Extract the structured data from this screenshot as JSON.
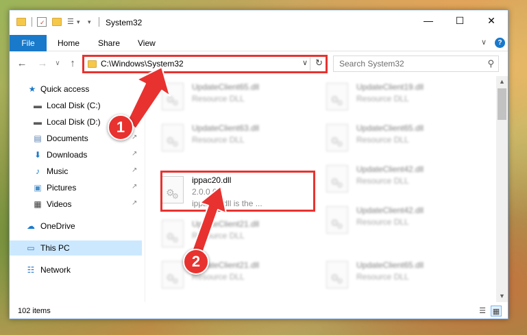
{
  "window": {
    "title": "System32",
    "controls": {
      "minimize": "—",
      "maximize": "☐",
      "close": "✕"
    }
  },
  "ribbon": {
    "tabs": [
      "File",
      "Home",
      "Share",
      "View"
    ],
    "expand_glyph": "∨",
    "help_glyph": "?"
  },
  "navigation": {
    "back": "←",
    "forward": "→",
    "up": "↑",
    "recent": "∨",
    "address": "C:\\Windows\\System32",
    "dropdown": "∨",
    "refresh": "↻"
  },
  "search": {
    "placeholder": "Search System32",
    "icon": "search-icon"
  },
  "sidebar": {
    "items": [
      {
        "label": "Quick access",
        "icon": "star-icon",
        "glyph": "★",
        "color": "#1979ca"
      },
      {
        "label": "Local Disk (C:)",
        "icon": "drive-icon",
        "glyph": "▬",
        "color": "#5a5a5a",
        "pinned": false
      },
      {
        "label": "Local Disk (D:)",
        "icon": "drive-icon",
        "glyph": "▬",
        "color": "#5a5a5a",
        "pinned": true
      },
      {
        "label": "Documents",
        "icon": "documents-icon",
        "glyph": "▤",
        "color": "#5a7fb0",
        "pinned": true
      },
      {
        "label": "Downloads",
        "icon": "downloads-icon",
        "glyph": "⬇",
        "color": "#1979ca",
        "pinned": true
      },
      {
        "label": "Music",
        "icon": "music-icon",
        "glyph": "♪",
        "color": "#1979ca",
        "pinned": true
      },
      {
        "label": "Pictures",
        "icon": "pictures-icon",
        "glyph": "▣",
        "color": "#4a90c8",
        "pinned": true
      },
      {
        "label": "Videos",
        "icon": "videos-icon",
        "glyph": "▦",
        "color": "#3a3a3a",
        "pinned": true
      },
      {
        "label": "OneDrive",
        "icon": "onedrive-icon",
        "glyph": "☁",
        "color": "#1979ca"
      },
      {
        "label": "This PC",
        "icon": "computer-icon",
        "glyph": "▭",
        "color": "#2b79c6",
        "selected": true
      },
      {
        "label": "Network",
        "icon": "network-icon",
        "glyph": "☷",
        "color": "#2b79c6"
      }
    ],
    "pin_glyph": "↗"
  },
  "files": [
    {
      "name": "UpdateClient65.dll",
      "desc": "Resource DLL",
      "blurred": true
    },
    {
      "name": "UpdateClient19.dll",
      "desc": "Resource DLL",
      "blurred": true
    },
    {
      "name": "UpdateClient63.dll",
      "desc": "Resource DLL",
      "blurred": true
    },
    {
      "name": "UpdateClient65.dll",
      "desc": "Resource DLL",
      "blurred": true
    },
    {
      "name": "ippac20.dll",
      "desc": "2.0.0.0",
      "extra": "ippac20.dll is the ...",
      "blurred": false,
      "highlighted": true
    },
    {
      "name": "UpdateClient42.dll",
      "desc": "Resource DLL",
      "blurred": true
    },
    {
      "name": "UpdateClient21.dll",
      "desc": "Resource DLL",
      "blurred": true
    },
    {
      "name": "UpdateClient42.dll",
      "desc": "Resource DLL",
      "blurred": true
    },
    {
      "name": "UpdateClient21.dll",
      "desc": "Resource DLL",
      "blurred": true
    },
    {
      "name": "UpdateClient65.dll",
      "desc": "Resource DLL",
      "blurred": true
    }
  ],
  "status": {
    "item_count": "102 items"
  },
  "annotations": {
    "step1": "1",
    "step2": "2",
    "color": "#e8322f"
  }
}
